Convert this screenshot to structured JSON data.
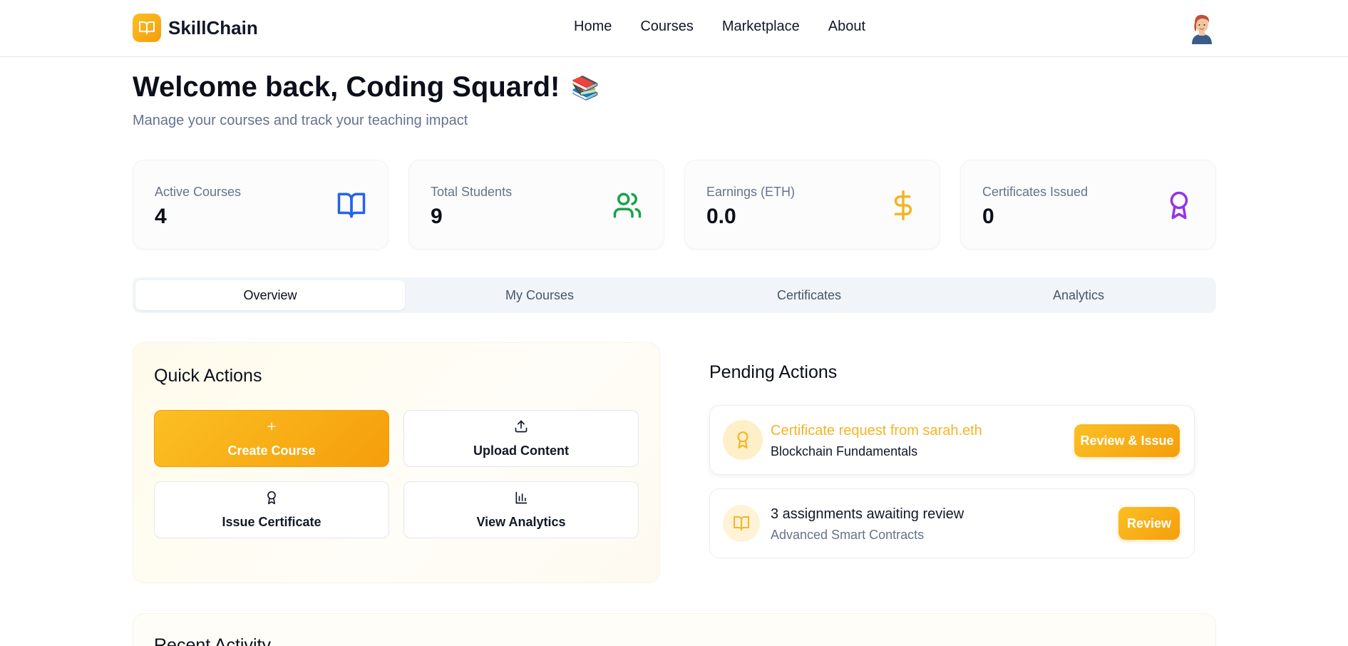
{
  "header": {
    "brand": "SkillChain",
    "nav": [
      "Home",
      "Courses",
      "Marketplace",
      "About"
    ]
  },
  "welcome": {
    "title": "Welcome back, Coding Squard!",
    "emoji": "📚",
    "subtitle": "Manage your courses and track your teaching impact"
  },
  "stats": [
    {
      "label": "Active Courses",
      "value": "4",
      "icon": "book-open-icon",
      "color": "#2563eb"
    },
    {
      "label": "Total Students",
      "value": "9",
      "icon": "users-icon",
      "color": "#16a34a"
    },
    {
      "label": "Earnings (ETH)",
      "value": "0.0",
      "icon": "dollar-icon",
      "color": "#f5b423"
    },
    {
      "label": "Certificates Issued",
      "value": "0",
      "icon": "award-icon",
      "color": "#9333ea"
    }
  ],
  "tabs": [
    {
      "label": "Overview",
      "active": true
    },
    {
      "label": "My Courses",
      "active": false
    },
    {
      "label": "Certificates",
      "active": false
    },
    {
      "label": "Analytics",
      "active": false
    }
  ],
  "quick_actions": {
    "title": "Quick Actions",
    "buttons": [
      {
        "label": "Create Course",
        "icon": "plus-icon"
      },
      {
        "label": "Upload Content",
        "icon": "upload-icon"
      },
      {
        "label": "Issue Certificate",
        "icon": "award-icon"
      },
      {
        "label": "View Analytics",
        "icon": "bar-chart-icon"
      }
    ]
  },
  "pending_actions": {
    "title": "Pending Actions",
    "items": [
      {
        "title": "Certificate request from sarah.eth",
        "subtitle": "Blockchain Fundamentals",
        "button": "Review & Issue",
        "icon": "award-icon"
      },
      {
        "title": "3 assignments awaiting review",
        "subtitle": "Advanced Smart Contracts",
        "button": "Review",
        "icon": "book-open-icon"
      }
    ]
  },
  "recent_activity": {
    "title": "Recent Activity"
  },
  "colors": {
    "accent": "#f59e0b",
    "accent_light": "#fbbf24"
  }
}
